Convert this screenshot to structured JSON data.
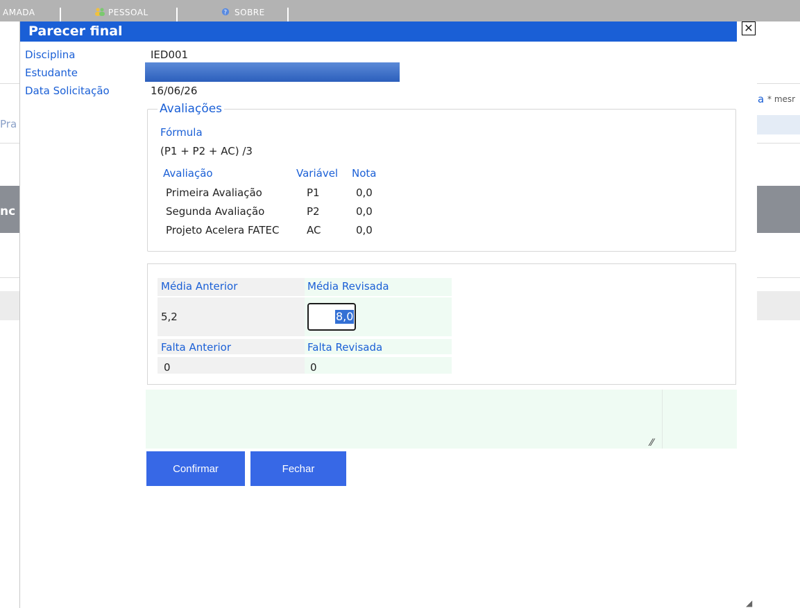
{
  "background": {
    "menu": [
      {
        "label": "AMADA"
      },
      {
        "label": "PESSOAL",
        "icon": "users-icon"
      },
      {
        "label": "SOBRE",
        "icon": "help-circle-icon"
      }
    ],
    "right_snippet": "a",
    "right_note": "* mesr",
    "left_snippet_1": "Pra",
    "left_snippet_2": "nc"
  },
  "modal": {
    "title": "Parecer final",
    "close_label": "✕",
    "fields": {
      "disciplina_label": "Disciplina",
      "disciplina_value": "IED001",
      "estudante_label": "Estudante",
      "data_label": "Data Solicitação",
      "data_value": "16/06/26"
    },
    "avaliacoes": {
      "legend": "Avaliações",
      "formula_label": "Fórmula",
      "formula_value": "(P1 + P2 + AC) /3",
      "headers": {
        "avaliacao": "Avaliação",
        "variavel": "Variável",
        "nota": "Nota"
      },
      "rows": [
        {
          "name": "Primeira Avaliação",
          "var": "P1",
          "nota": "0,0"
        },
        {
          "name": "Segunda Avaliação",
          "var": "P2",
          "nota": "0,0"
        },
        {
          "name": "Projeto Acelera FATEC",
          "var": "AC",
          "nota": "0,0"
        }
      ]
    },
    "revisao": {
      "media_anterior_label": "Média Anterior",
      "media_anterior_value": "5,2",
      "media_revisada_label": "Média Revisada",
      "media_revisada_value": "8,0",
      "falta_anterior_label": "Falta Anterior",
      "falta_anterior_value": "0",
      "falta_revisada_label": "Falta Revisada",
      "falta_revisada_value": "0"
    },
    "notes_value": "",
    "buttons": {
      "confirm": "Confirmar",
      "close": "Fechar"
    }
  },
  "colors": {
    "accent": "#1a5fd6",
    "button": "#3768e6",
    "green_bg": "#effbf3"
  }
}
